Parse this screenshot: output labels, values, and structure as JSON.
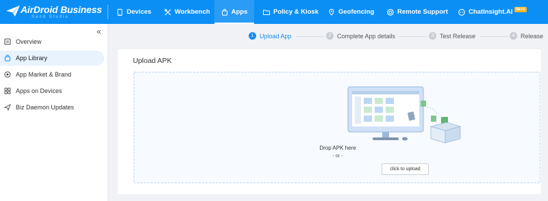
{
  "brand": {
    "title": "AirDroid Business",
    "subtitle": "Sand Studio"
  },
  "nav": {
    "devices": "Devices",
    "workbench": "Workbench",
    "apps": "Apps",
    "policy": "Policy & Kiosk",
    "geofencing": "Geofencing",
    "remote_support": "Remote Support",
    "chat_insight": "ChatInsight.AI",
    "beta": "BETA"
  },
  "sidebar": {
    "collapse_icon": "double-chevron-left-icon",
    "items": [
      {
        "label": "Overview",
        "icon": "overview-icon"
      },
      {
        "label": "App Library",
        "icon": "library-icon"
      },
      {
        "label": "App Market & Brand",
        "icon": "market-icon"
      },
      {
        "label": "Apps on Devices",
        "icon": "apps-grid-icon"
      },
      {
        "label": "Biz Daemon Updates",
        "icon": "send-icon"
      }
    ],
    "active_index": 1
  },
  "steps": [
    {
      "num": "1",
      "label": "Upload App"
    },
    {
      "num": "2",
      "label": "Complete App details"
    },
    {
      "num": "3",
      "label": "Test Release"
    },
    {
      "num": "4",
      "label": "Release"
    }
  ],
  "upload": {
    "title": "Upload APK",
    "drop_text": "Drop APK here",
    "or_text": "- or -",
    "button": "click to upload"
  },
  "colors": {
    "brand_blue": "#0c8ff5",
    "active_step": "#1a8cf0",
    "beta_badge": "#f7b52c"
  }
}
